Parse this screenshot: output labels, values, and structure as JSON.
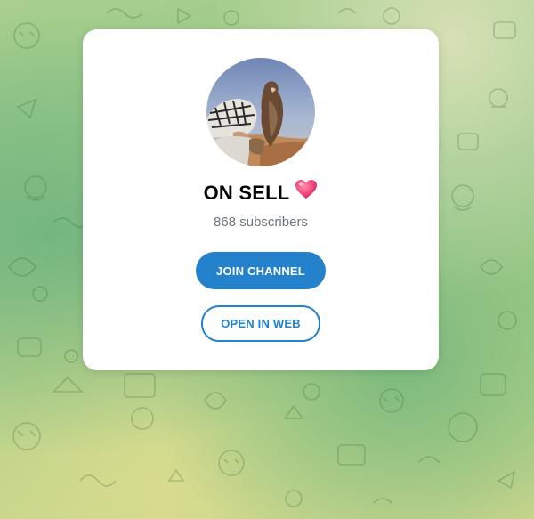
{
  "channel": {
    "name": "ON SELL",
    "emoji_icon": "pink-heart-icon",
    "subscribers": "868 subscribers",
    "avatar_description": "falconer-avatar"
  },
  "actions": {
    "join_label": "JOIN CHANNEL",
    "web_label": "OPEN IN WEB"
  },
  "colors": {
    "accent": "#2481cc",
    "heart": "#f0467a",
    "muted_text": "#707579",
    "card": "#ffffff"
  }
}
